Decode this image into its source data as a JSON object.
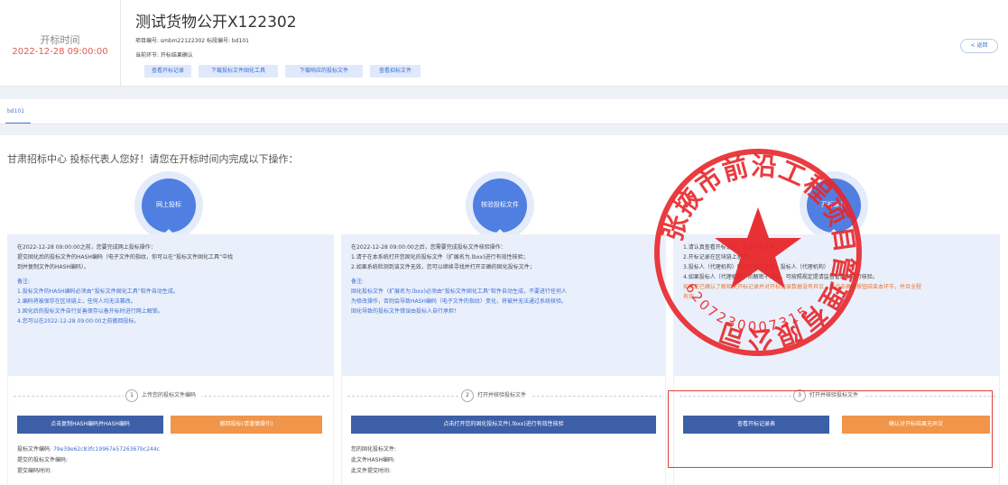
{
  "header": {
    "open_label": "开标时间",
    "open_time": "2022-12-28 09:00:00",
    "title": "测试货物公开X122302",
    "meta1": "项目编号: smbm22122302  标段编号: bd101",
    "meta2": "当前环节: 开标结果确认",
    "buttons": [
      "查看开标记录",
      "下载投标文件固化工具",
      "下载响应的投标文件",
      "查看招标文件"
    ],
    "back_label": "< 返回"
  },
  "tab": {
    "label": "bd101"
  },
  "greeting": "甘肃招标中心 投标代表人您好！请您在开标时间内完成以下操作：",
  "steps": [
    {
      "circle": "网上投标",
      "lines": [
        "在2022-12-28 09:00:00之前，您要完成网上投标操作：",
        "提交固化后的投标文件的HASH编码（电子文件的指纹，你可以在“投标文件固化工具”中找",
        "到并复制文件的HASH编码）。"
      ],
      "note_title": "备注:",
      "notes": [
        "1.投标文件的HASH编码必须由“投标文件固化工具”软件自动生成。",
        "2.编码将被保存在区块链上，任何人均无法篡改。",
        "3.固化后的投标文件自行妥善保存以备开标时进行网上解锁。",
        "4.您可以在2022-12-28 09:00:00之前撤回投标。"
      ],
      "step_no": "1",
      "step_text": "上传您的投标文件编码",
      "btn1": "点击复制HASH编码并HASH编码",
      "btn2": "撤回投标(请谨慎操作)",
      "info": [
        {
          "label": "投标文件编码:",
          "value": "79e39e62c83fc19967e5726367bc244c"
        },
        {
          "label": "提交的投标文件编码:",
          "value": ""
        },
        {
          "label": "提交编码时间:",
          "value": ""
        }
      ]
    },
    {
      "circle": "核验投标文件",
      "lines": [
        "在2022-12-28 09:00:00之后，您需要完成投标文件核验操作：",
        "1.请于在本系统打开您固化的投标文件（扩展名为.lbxx)进行有效性核验；",
        "2.如果系统检测到该文件无效，您可以继续寻找并打开正确的固化投标文件；"
      ],
      "note_title": "备注:",
      "notes": [
        "固化投标文件（扩展名为.lbxx)必须由“投标文件固化工具”软件自动生成，不要进行任何人",
        "为修改操作，否则会导致HASH编码（电子文件的指纹）变化，将被并无法通过系统核验。",
        "固化导致的投标文件错误由投标人自行承担！"
      ],
      "step_no": "2",
      "step_text": "打开并核验投标文件",
      "btn1": "点击打开您的固化投标文件(.lbxx)进行有效性核验",
      "btn2": "",
      "info": [
        {
          "label": "您的固化投标文件:",
          "value": ""
        },
        {
          "label": "此文件HASH编码:",
          "value": ""
        },
        {
          "label": "此文件提交时间:",
          "value": ""
        }
      ]
    },
    {
      "circle": "开标确认",
      "lines": [
        "1.请认真查看开标记录，确认开标结果“",
        "2.开标记录在区块链上留存，",
        "3.投标人（代理机构）确认开标记录后，投标人（代理机构）",
        "4.如果投标人（代理机构）的解密不通过，可按照规定提请监督管理下进行核验。"
      ],
      "note_title": "",
      "notes": [
        "如果您已确认了解相关开标记录并对开标记录数据没有异议，请点击确认按钮结束本环节，并且全程",
        "有效。"
      ],
      "step_no": "3",
      "step_text": "打开并核验投标文件",
      "btn1": "查看开标记录表",
      "btn2": "确认对开标结果无异议",
      "info": []
    }
  ],
  "seal": {
    "name": "张掖市前沿工程项目管理有限公司",
    "code": "6207230007315"
  }
}
